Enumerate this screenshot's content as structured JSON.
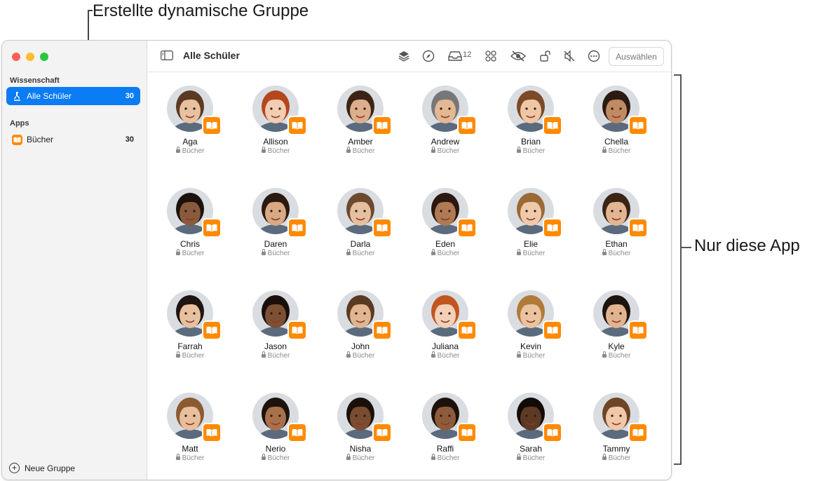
{
  "callouts": {
    "top": "Erstellte dynamische Gruppe",
    "right": "Nur diese App"
  },
  "sidebar": {
    "sections": [
      {
        "title": "Wissenschaft"
      },
      {
        "title": "Apps"
      }
    ],
    "items": [
      {
        "label": "Alle Schüler",
        "count": "30",
        "icon": "microscope-icon",
        "selected": true
      },
      {
        "label": "Bücher",
        "count": "30",
        "icon": "books-app-icon",
        "selected": false
      }
    ],
    "new_group": "Neue Gruppe"
  },
  "toolbar": {
    "title": "Alle Schüler",
    "icons": [
      "sidebar-toggle-icon",
      "layers-icon",
      "compass-icon",
      "tray-icon",
      "apps-grid-icon",
      "eye-slash-icon",
      "unlock-icon",
      "mute-icon",
      "more-icon"
    ],
    "tray_count": "12",
    "select_label": "Auswählen"
  },
  "students": [
    {
      "name": "Aga",
      "app": "Bücher",
      "skin": "#e8c1a0",
      "hair": "#5a3a22"
    },
    {
      "name": "Allison",
      "app": "Bücher",
      "skin": "#f2cdb2",
      "hair": "#b5471f"
    },
    {
      "name": "Amber",
      "app": "Bücher",
      "skin": "#dcae8c",
      "hair": "#3b2416"
    },
    {
      "name": "Andrew",
      "app": "Bücher",
      "skin": "#e3b893",
      "hair": "#777777"
    },
    {
      "name": "Brian",
      "app": "Bücher",
      "skin": "#eec7a5",
      "hair": "#7b4a27"
    },
    {
      "name": "Chella",
      "app": "Bücher",
      "skin": "#c08a63",
      "hair": "#2b1a12"
    },
    {
      "name": "Chris",
      "app": "Bücher",
      "skin": "#8a5a3c",
      "hair": "#1c120c"
    },
    {
      "name": "Daren",
      "app": "Bücher",
      "skin": "#d9a884",
      "hair": "#2a1a10"
    },
    {
      "name": "Darla",
      "app": "Bücher",
      "skin": "#e6bfa0",
      "hair": "#6b4a2e"
    },
    {
      "name": "Eden",
      "app": "Bücher",
      "skin": "#b07a55",
      "hair": "#2b1810"
    },
    {
      "name": "Elie",
      "app": "Bücher",
      "skin": "#f0c9ab",
      "hair": "#9a6a35"
    },
    {
      "name": "Ethan",
      "app": "Bücher",
      "skin": "#e2b692",
      "hair": "#3a2416"
    },
    {
      "name": "Farrah",
      "app": "Bücher",
      "skin": "#e7c0a0",
      "hair": "#201410"
    },
    {
      "name": "Jason",
      "app": "Bücher",
      "skin": "#7d5034",
      "hair": "#1a0f0a"
    },
    {
      "name": "John",
      "app": "Bücher",
      "skin": "#e0b591",
      "hair": "#5a3a22"
    },
    {
      "name": "Juliana",
      "app": "Bücher",
      "skin": "#f3d0b6",
      "hair": "#c2561f"
    },
    {
      "name": "Kevin",
      "app": "Bücher",
      "skin": "#eac39f",
      "hair": "#b07a3a"
    },
    {
      "name": "Kyle",
      "app": "Bücher",
      "skin": "#e0b48e",
      "hair": "#1d140e"
    },
    {
      "name": "Matt",
      "app": "Bücher",
      "skin": "#e8bf9c",
      "hair": "#8a5a32"
    },
    {
      "name": "Nerio",
      "app": "Bücher",
      "skin": "#a8714c",
      "hair": "#1e130c"
    },
    {
      "name": "Nisha",
      "app": "Bücher",
      "skin": "#7a4c30",
      "hair": "#1a100a"
    },
    {
      "name": "Raffi",
      "app": "Bücher",
      "skin": "#8e5c3c",
      "hair": "#1d120b"
    },
    {
      "name": "Sarah",
      "app": "Bücher",
      "skin": "#5e3a25",
      "hair": "#120b07"
    },
    {
      "name": "Tammy",
      "app": "Bücher",
      "skin": "#f0c8a8",
      "hair": "#6e4526"
    }
  ],
  "colors": {
    "accent": "#0a7cf4",
    "app_badge": "#ff8a00"
  }
}
